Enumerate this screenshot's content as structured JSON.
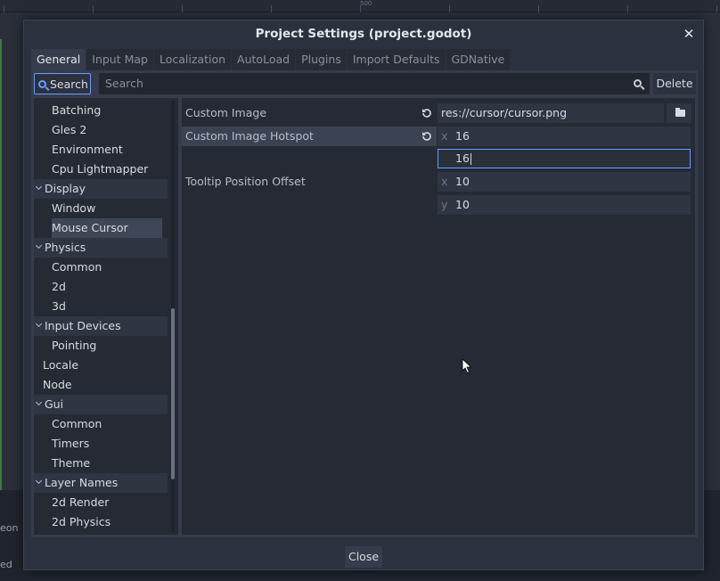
{
  "background": {
    "ruler_label": "500",
    "bottom_text_1": "eon",
    "bottom_text_2": "ed"
  },
  "dialog": {
    "title": "Project Settings (project.godot)",
    "close_label": "Close",
    "tabs": [
      {
        "label": "General",
        "active": true
      },
      {
        "label": "Input Map"
      },
      {
        "label": "Localization"
      },
      {
        "label": "AutoLoad"
      },
      {
        "label": "Plugins"
      },
      {
        "label": "Import Defaults"
      },
      {
        "label": "GDNative"
      }
    ],
    "search_button": "Search",
    "search_placeholder": "Search",
    "delete_label": "Delete"
  },
  "tree": {
    "items": [
      {
        "label": "Batching",
        "level": 1
      },
      {
        "label": "Gles 2",
        "level": 1
      },
      {
        "label": "Environment",
        "level": 1
      },
      {
        "label": "Cpu Lightmapper",
        "level": 1
      },
      {
        "label": "Display",
        "level": 0,
        "category": true
      },
      {
        "label": "Window",
        "level": 1
      },
      {
        "label": "Mouse Cursor",
        "level": 1,
        "selected": true
      },
      {
        "label": "Physics",
        "level": 0,
        "category": true
      },
      {
        "label": "Common",
        "level": 1
      },
      {
        "label": "2d",
        "level": 1
      },
      {
        "label": "3d",
        "level": 1
      },
      {
        "label": "Input Devices",
        "level": 0,
        "category": true
      },
      {
        "label": "Pointing",
        "level": 1
      },
      {
        "label": "Locale",
        "level": 0
      },
      {
        "label": "Node",
        "level": 0
      },
      {
        "label": "Gui",
        "level": 0,
        "category": true
      },
      {
        "label": "Common",
        "level": 1
      },
      {
        "label": "Timers",
        "level": 1
      },
      {
        "label": "Theme",
        "level": 1
      },
      {
        "label": "Layer Names",
        "level": 0,
        "category": true
      },
      {
        "label": "2d Render",
        "level": 1
      },
      {
        "label": "2d Physics",
        "level": 1
      }
    ]
  },
  "properties": {
    "custom_image": {
      "label": "Custom Image",
      "value": "res://cursor/cursor.png"
    },
    "custom_image_hotspot": {
      "label": "Custom Image Hotspot",
      "x_axis": "x",
      "x": "16",
      "y_editing": "16"
    },
    "tooltip_position_offset": {
      "label": "Tooltip Position Offset",
      "x_axis": "x",
      "x": "10",
      "y_axis": "y",
      "y": "10"
    }
  },
  "colors": {
    "accent": "#6b9cff",
    "panel": "#363c4b",
    "field": "#252a34"
  }
}
